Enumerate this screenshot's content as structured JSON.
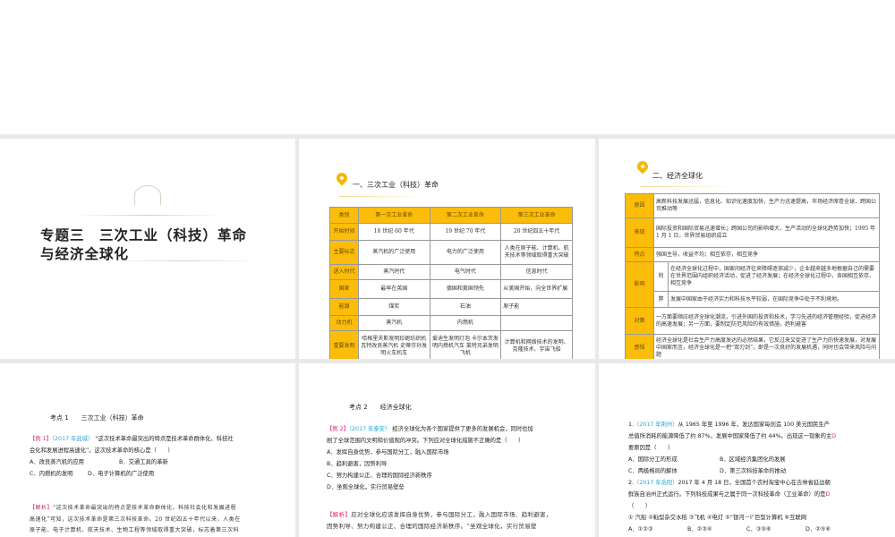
{
  "slide1": {
    "title_line1": "专题三　三次工业（科技）革命",
    "title_line2": "与经济全球化"
  },
  "slide2": {
    "section": "一、三次工业（科技）革命",
    "headers": [
      "类别",
      "第一次工业革命",
      "第二次工业革命",
      "第三次工业革命"
    ],
    "rows": [
      [
        "开始时间",
        "18 世纪 60 年代",
        "19 世纪 70 年代",
        "20 世纪四五十年代"
      ],
      [
        "主要标志",
        "蒸汽机的广泛使用",
        "电力的广泛使用",
        "人类在原子能、计算机、航天技术等领域取得重大突破"
      ],
      [
        "进入时代",
        "蒸汽时代",
        "电气时代",
        "信息时代"
      ],
      [
        "国家",
        "最早在英国",
        "德国和美国领先",
        "从美国开始，向全世界扩展"
      ],
      [
        "能源",
        "煤炭",
        "石油",
        "原子能"
      ],
      [
        "动力机",
        "蒸汽机",
        "内燃机",
        ""
      ],
      [
        "重要发明",
        "哈格里夫斯发明珍妮纺织机 瓦特改良蒸汽机 史蒂芬孙发明火车机车",
        "爱迪生发明灯泡 卡尔本茨发明内燃机汽车 莱特兄弟发明飞机",
        "计算机和网络技术的发明、克隆技术、宇宙飞船"
      ]
    ]
  },
  "slide3": {
    "section": "二、经济全球化",
    "reason_label": "原因",
    "reason": "高新科技发展迅猛，信息化、知识化速度加快，生产力迅速提高，市场经济席卷全球，跨国公司推动等",
    "show_label": "表现",
    "show": "国际投资和国际贸易迅速增长；跨国公司的影响增大，生产活动的全球化趋势加快；1995 年 1 月 1 日，世界贸易组织成立",
    "feature_label": "特点",
    "feature": "强国主导，收益不均；相互依存，相互竞争",
    "impact_label": "影响",
    "pro_label": "利",
    "pro": "在经济全球化过程中，国家间经济往来障碍逐渐减少，企业越来越多地根据自己的需要在世界范围内组织经济活动，促进了经济发展；在经济全球化过程中，各国相互依存、相互竞争",
    "con_label": "弊",
    "con": "发展中国家由于经济实力和科技水平较弱，在国际竞争中处于不利境地。",
    "policy_label": "对策",
    "policy": "一方面要顺应经济全球化潮流，引进外国的投资和技术，学习先进的经济管理经验，促进经济的高速发展；另一方面，要制定防范风险的有效措施，趋利避害",
    "insight_label": "感悟",
    "insight": "经济全球化是社会生产力高度发达的必然结果，它反过来又促进了生产力的快速发展，对发展中国家而言，经济全球化是一把“双刃剑”，即是一次良好的发展机遇，同时也会带来风险与问题"
  },
  "slide4": {
    "heading": "考点 1　　三次工业（科技）革命",
    "tag": "【例 1】",
    "source": "（2017 年盐城）",
    "q1": "“这次技术革命最突出的特点是技术革命群体化、科技社",
    "q2": "会化和发展进程高速化”。这次技术革命的核心是（　　）",
    "optA": "A．改良蒸汽机的应用",
    "optB": "B．交通工具的革新",
    "optC": "C．内燃机的发明",
    "optD": "D．电子计算机的广泛使用",
    "analysis_tag": "【解析】",
    "a1": "“这次技术革命最突出的特点是技术革命群体化，科技社会化和发展进程",
    "a2": "高速化”可知，这次技术革命是第三次科技革命。20 世纪四五十年代以来，人类在",
    "a3": "原子能、电子计算机、航天技术、生物工程等领域取得重大突破，标志着第三次科"
  },
  "slide5": {
    "heading": "考点 2　　经济全球化",
    "tag": "【例 2】",
    "source": "（2017 年泰安）",
    "q1": "经济全球化为各个国家提供了更多的发展机会，同时也加",
    "q2": "剧了全球范围内文明和价值观的冲突。下列应对全球化措施不正确的是（　　）",
    "optA": "A．发挥自身优势，参与国际分工，融入国际市场",
    "optB": "B．趋利避害，因势利导",
    "optC": "C．努力构建公正、合理的国际经济新秩序",
    "optD": "D．坐观全球化，实行贸易壁垒",
    "analysis_tag": "【解析】",
    "a1": "应对全球化应该发挥自身优势，参与国际分工，融入国际市场、趋利避害，",
    "a2": "因势利导、努力构建公正、合理的国际经济新秩序。“坐观全球化，实行贸易壁"
  },
  "slide6": {
    "n1": "1.",
    "src1": "（2017 年荆州）",
    "q1a": "从 1965 年至 1996 年，发达国家每创造 100 美元国民生产",
    "q1b": "总值所消耗的能源降低了约 87%，发展中国家降低了约 44%。出现这一现象的主",
    "q1c": "要原因是（　　）",
    "ans1": "D",
    "o1A": "A．国际分工的形成",
    "o1B": "B．区域经济集团化的发展",
    "o1C": "C．两极格局的解体",
    "o1D": "D．第三次科技革命的推动",
    "n2": "2.",
    "src2": "（2017 年岳阳）",
    "q2a": "2017 年 4 月 18 日，全国首个农村淘宝中心在吉林省延边朝",
    "q2b": "鲜族自治州正式运行。下列科技成果与之属于同一次科技革命（工业革命）的是",
    "q2c": "（　　）",
    "ans2": "D",
    "items": "① 汽船 ②籼型杂交水稻 ③飞机 ④电灯 ⑤“银河－Ⅰ”巨型计算机 ⑥互联网",
    "o2A": "A．①②③",
    "o2B": "B．②③④",
    "o2C": "C．③⑤⑥",
    "o2D": "D．②⑤⑥"
  }
}
